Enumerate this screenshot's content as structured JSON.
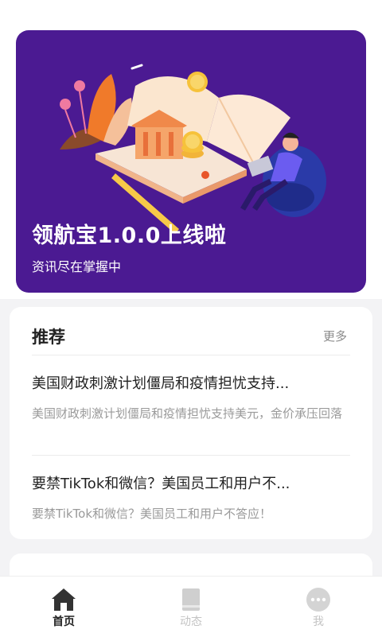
{
  "banner": {
    "title": "领航宝1.0.0上线啦",
    "subtitle": "资讯尽在掌握中",
    "background_color": "#4b1a92"
  },
  "recommend": {
    "title": "推荐",
    "more_label": "更多",
    "items": [
      {
        "title": "美国财政刺激计划僵局和疫情担忧支持...",
        "description": "美国财政刺激计划僵局和疫情担忧支持美元，金价承压回落"
      },
      {
        "title": "要禁TikTok和微信？美国员工和用户不...",
        "description": "要禁TikTok和微信？美国员工和用户不答应！"
      }
    ]
  },
  "next_section": {
    "peek_text": "……"
  },
  "tabbar": {
    "items": [
      {
        "label": "首页",
        "icon": "home-icon",
        "active": true
      },
      {
        "label": "动态",
        "icon": "book-icon",
        "active": false
      },
      {
        "label": "我",
        "icon": "more-dots-icon",
        "active": false
      }
    ]
  }
}
